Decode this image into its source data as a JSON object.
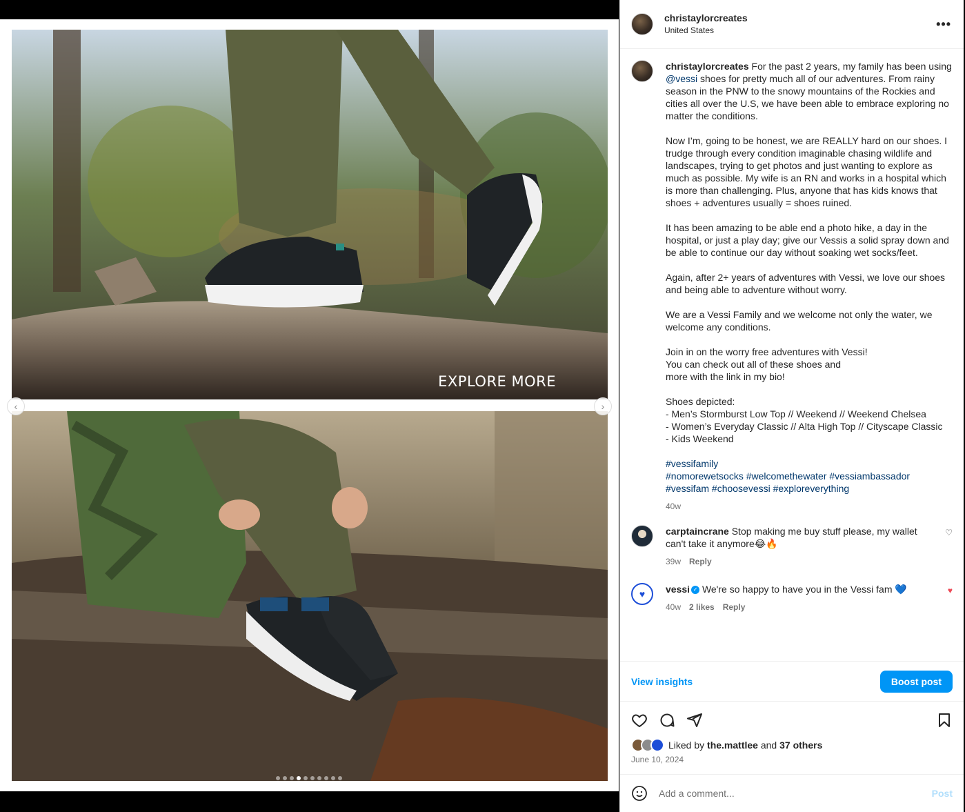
{
  "media": {
    "overlay_text": "EXPLORE MORE",
    "prev_icon": "‹",
    "next_icon": "›",
    "dot_count": 10,
    "active_dot": 3
  },
  "header": {
    "username": "christaylorcreates",
    "location": "United States",
    "more_icon": "•••"
  },
  "caption": {
    "username": "christaylorcreates",
    "text_before_mention": "For the past 2 years, my family has been using ",
    "mention": "@vessi",
    "text_after_mention": " shoes for pretty much all of our adventures. From rainy season in the PNW to the snowy mountains of the Rockies and cities all over the U.S, we have been able to embrace exploring no matter the conditions.\n\nNow I’m, going to be honest, we are REALLY hard on our shoes. I trudge through every condition imaginable chasing wildlife and landscapes, trying to get photos and just wanting to explore as much as possible. My wife is an RN and works in a hospital which is more than challenging. Plus, anyone that has kids knows that shoes + adventures usually = shoes ruined.\n\nIt has been amazing to be able end a photo hike, a day in the hospital, or just a play day; give our Vessis a solid spray down and be able to continue our day without soaking wet socks/feet.\n\nAgain, after 2+ years of adventures with Vessi, we love our shoes and being able to adventure without worry.\n\nWe are a Vessi Family and we welcome not only the water, we welcome any conditions.\n\nJoin in on the worry free adventures with Vessi!\nYou can check out all of these shoes and\nmore with the link in my bio!\n\nShoes depicted:\n- Men’s Stormburst Low Top // Weekend // Weekend Chelsea\n- Women’s Everyday Classic // Alta High Top // Cityscape Classic\n- Kids Weekend\n\n",
    "hashtags": "#vessifamily\n#nomorewetsocks #welcomethewater #vessiambassador\n#vessifam #choosevessi #exploreverything",
    "time": "40w"
  },
  "comments": [
    {
      "username": "carptaincrane",
      "text": "Stop making me buy stuff please, my wallet can't take it anymore😂🔥",
      "time": "39w",
      "reply": "Reply"
    },
    {
      "username": "vessi",
      "verified_icon": "✓",
      "text": "We're so happy to have you in the Vessi fam 💙",
      "time": "40w",
      "likes": "2 likes",
      "reply": "Reply"
    }
  ],
  "insights": {
    "view_label": "View insights",
    "boost_label": "Boost post"
  },
  "likes": {
    "prefix": "Liked by",
    "user": "the.mattlee",
    "and": "and",
    "others": "37 others"
  },
  "post_date": "June 10, 2024",
  "comment_input": {
    "placeholder": "Add a comment...",
    "post_label": "Post"
  },
  "colors": {
    "link": "#00376b",
    "accent": "#0095f6",
    "like_red": "#ed4956"
  }
}
